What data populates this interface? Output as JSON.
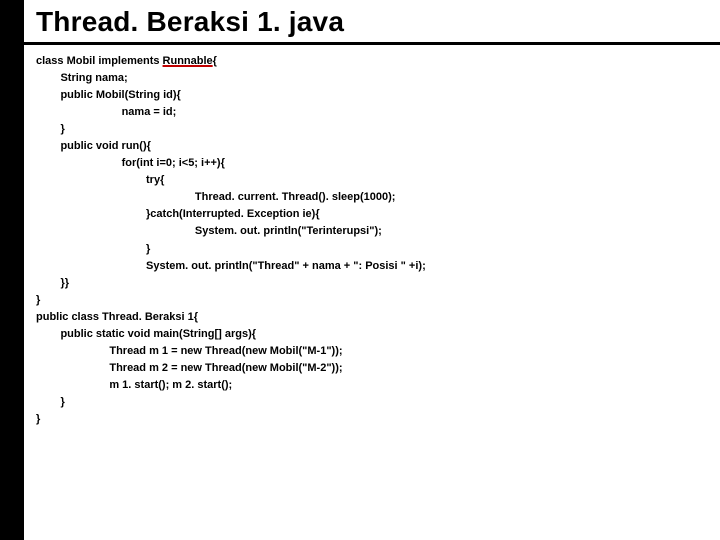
{
  "title": "Thread. Beraksi 1. java",
  "code": {
    "l1a": "class Mobil implements ",
    "l1b": "Runnable",
    "l1c": "{",
    "l2": "        String nama;",
    "l3": "        public Mobil(String id){",
    "l4": "                            nama = id;",
    "l5": "        }",
    "l6": "        public void run(){",
    "l7": "                            for(int i=0; i<5; i++){",
    "l8": "                                    try{",
    "l9": "                                                    Thread. current. Thread(). sleep(1000);",
    "l10": "                                    }catch(Interrupted. Exception ie){",
    "l11": "                                                    System. out. println(\"Terinterupsi\");",
    "l12": "                                    }",
    "l13": "                                    System. out. println(\"Thread\" + nama + \": Posisi \" +i);",
    "l14": "        }}",
    "l15": "}",
    "l16": "public class Thread. Beraksi 1{",
    "l17": "        public static void main(String[] args){",
    "l18": "                        Thread m 1 = new Thread(new Mobil(\"M-1\"));",
    "l19": "                        Thread m 2 = new Thread(new Mobil(\"M-2\"));",
    "l20": "                        m 1. start(); m 2. start();",
    "l21": "        }",
    "l22": "}"
  }
}
